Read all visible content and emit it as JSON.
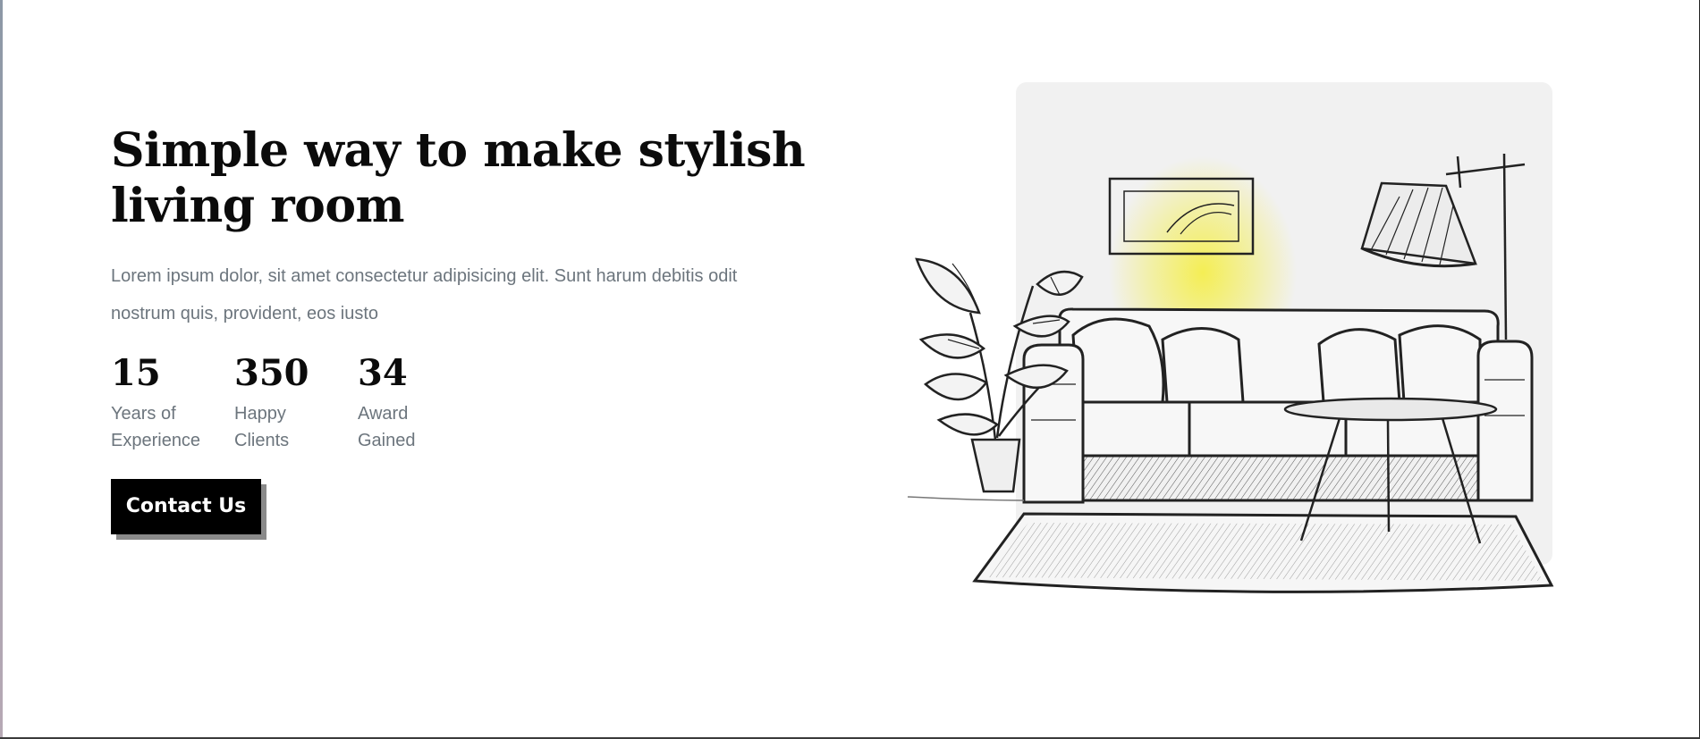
{
  "hero": {
    "title": "Simple way to make stylish living room",
    "description": "Lorem ipsum dolor, sit amet consectetur adipisicing elit. Sunt harum debitis odit nostrum quis, provident, eos iusto",
    "stats": [
      {
        "number": "15",
        "label": "Years of Experience"
      },
      {
        "number": "350",
        "label": "Happy Clients"
      },
      {
        "number": "34",
        "label": "Award Gained"
      }
    ],
    "cta_label": "Contact Us"
  },
  "illustration": {
    "subject": "sketch of living room with sofa, lamp, plant, table, rug",
    "lamp_glow_color": "#f4ee4c",
    "panel_color": "#f1f1f1"
  }
}
